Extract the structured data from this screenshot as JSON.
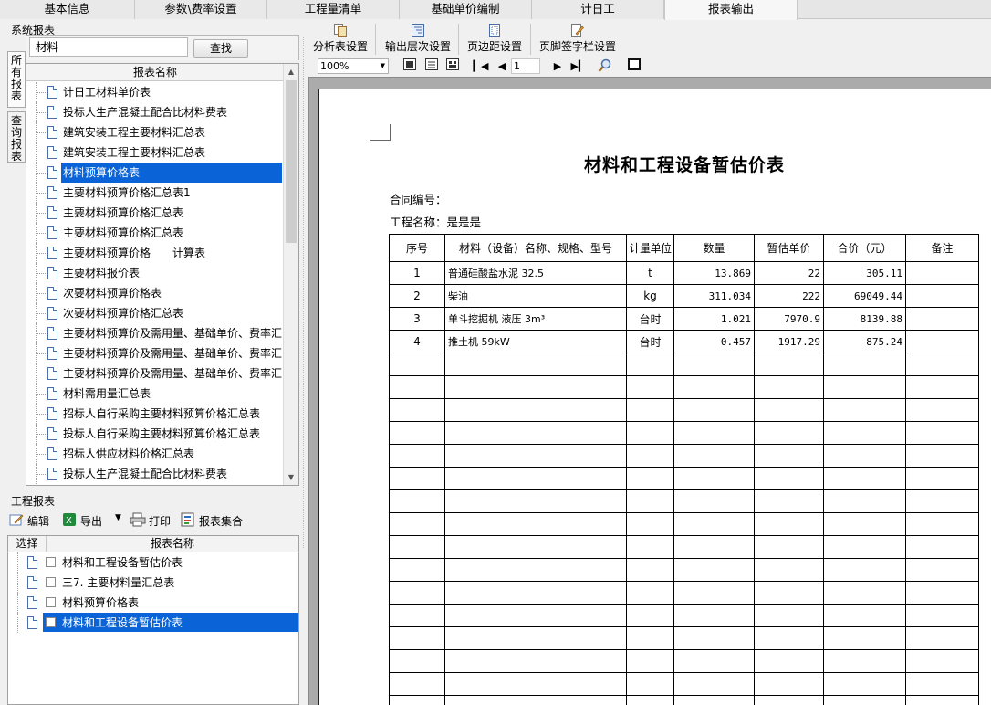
{
  "tabs": [
    "基本信息",
    "参数\\费率设置",
    "工程量清单",
    "基础单价编制",
    "计日工",
    "报表输出"
  ],
  "system_reports": {
    "title": "系统报表",
    "vtab_all": "所\n有\n报\n表",
    "vtab_query": "查\n询\n报\n表",
    "search_value": "材料",
    "search_button": "查找",
    "column": "报表名称",
    "items": [
      "计日工材料单价表",
      "投标人生产混凝土配合比材料费表",
      "建筑安装工程主要材料汇总表",
      "建筑安装工程主要材料汇总表",
      "材料预算价格表",
      "主要材料预算价格汇总表1",
      "主要材料预算价格汇总表",
      "主要材料预算价格汇总表",
      "主要材料预算价格　　计算表",
      "主要材料报价表",
      "次要材料预算价格表",
      "次要材料预算价格汇总表",
      "主要材料预算价及需用量、基础单价、费率汇",
      "主要材料预算价及需用量、基础单价、费率汇",
      "主要材料预算价及需用量、基础单价、费率汇",
      "材料需用量汇总表",
      "招标人自行采购主要材料预算价格汇总表",
      "投标人自行采购主要材料预算价格汇总表",
      "招标人供应材料价格汇总表",
      "投标人生产混凝土配合比材料费表"
    ],
    "selected_index": 4
  },
  "project_reports": {
    "title": "工程报表",
    "toolbar": {
      "edit": "编辑",
      "export": "导出",
      "print": "打印",
      "collection": "报表集合"
    },
    "col_select": "选择",
    "col_name": "报表名称",
    "items": [
      "材料和工程设备暂估价表",
      "三7. 主要材料量汇总表",
      "材料预算价格表",
      "材料和工程设备暂估价表"
    ],
    "selected_index": 3
  },
  "toolbar": {
    "analysis": "分析表设置",
    "level": "输出层次设置",
    "margin": "页边距设置",
    "footer": "页脚签字栏设置",
    "zoom": "100%",
    "page": "1"
  },
  "report": {
    "title": "材料和工程设备暂估价表",
    "contract_no": "合同编号：",
    "project_name": "工程名称：是是是",
    "headers": [
      "序号",
      "材料（设备）名称、规格、型号",
      "计量单位",
      "数量",
      "暂估单价",
      "合价（元）",
      "备注"
    ],
    "rows": [
      [
        "1",
        "普通硅酸盐水泥 32.5",
        "t",
        "13.869",
        "22",
        "305.11",
        ""
      ],
      [
        "2",
        "柴油",
        "kg",
        "311.034",
        "222",
        "69049.44",
        ""
      ],
      [
        "3",
        "单斗挖掘机 液压 3m³",
        "台时",
        "1.021",
        "7970.9",
        "8139.88",
        ""
      ],
      [
        "4",
        "推土机 59kW",
        "台时",
        "0.457",
        "1917.29",
        "875.24",
        ""
      ]
    ],
    "empty_rows": 16
  }
}
